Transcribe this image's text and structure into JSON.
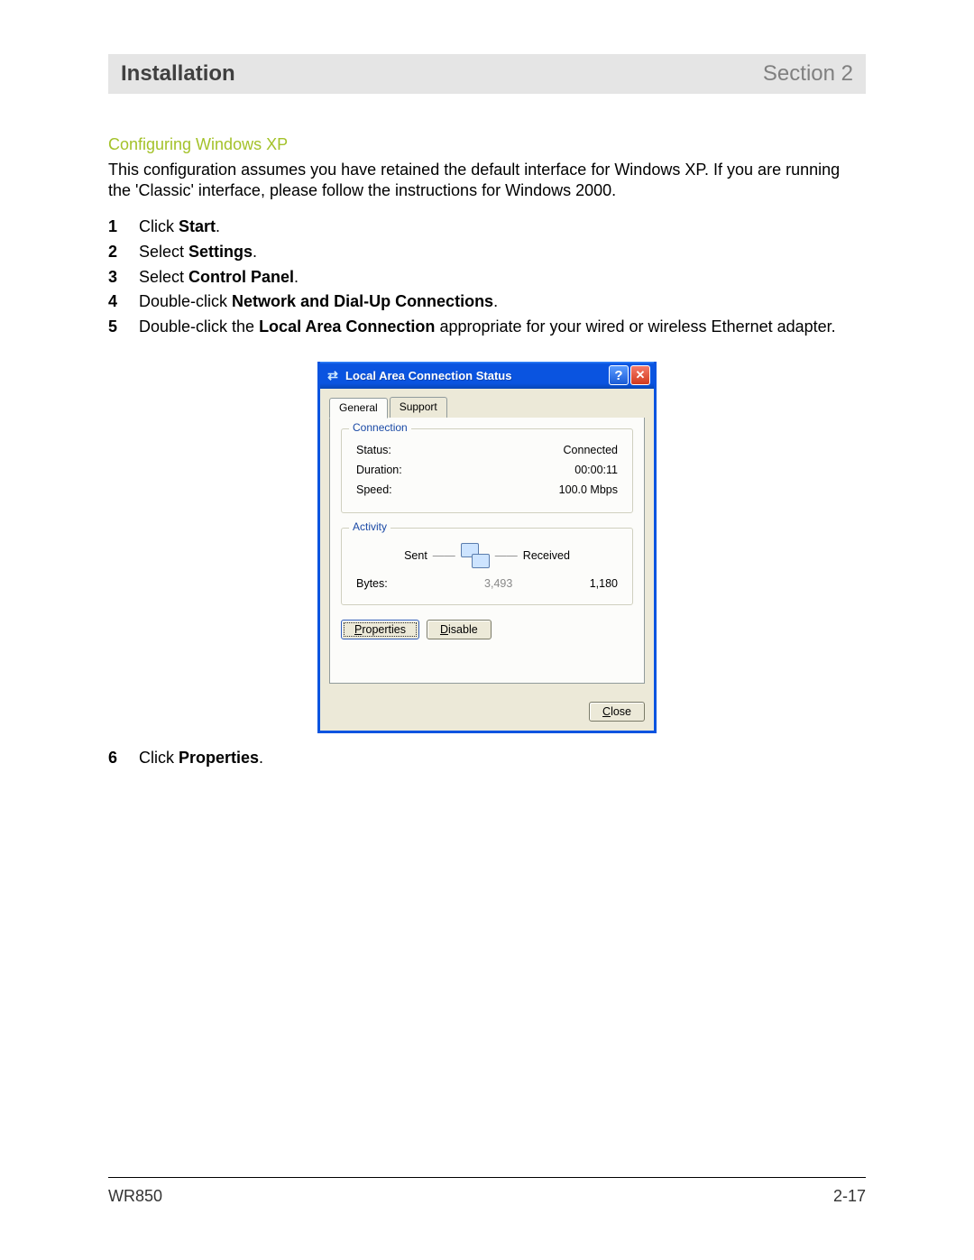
{
  "header": {
    "title": "Installation",
    "section": "Section 2"
  },
  "subheading": "Configuring Windows XP",
  "intro": "This configuration assumes you have retained the default interface for Windows XP. If you are running the 'Classic' interface, please follow the instructions for Windows 2000.",
  "steps": {
    "s1": {
      "num": "1",
      "pre": "Click ",
      "bold": "Start",
      "post": "."
    },
    "s2": {
      "num": "2",
      "pre": "Select ",
      "bold": "Settings",
      "post": "."
    },
    "s3": {
      "num": "3",
      "pre": "Select ",
      "bold": "Control Panel",
      "post": "."
    },
    "s4": {
      "num": "4",
      "pre": "Double-click ",
      "bold": "Network and Dial-Up Connections",
      "post": "."
    },
    "s5": {
      "num": "5",
      "pre": "Double-click the ",
      "bold": "Local Area Connection",
      "post": " appropriate for your wired or wireless Ethernet adapter."
    },
    "s6": {
      "num": "6",
      "pre": "Click ",
      "bold": "Properties",
      "post": "."
    }
  },
  "dialog": {
    "title": "Local Area Connection Status",
    "help_icon": "?",
    "close_icon": "✕",
    "tabs": {
      "general": "General",
      "support": "Support"
    },
    "group_connection": {
      "legend": "Connection",
      "status_label": "Status:",
      "status_value": "Connected",
      "duration_label": "Duration:",
      "duration_value": "00:00:11",
      "speed_label": "Speed:",
      "speed_value": "100.0 Mbps"
    },
    "group_activity": {
      "legend": "Activity",
      "sent_label": "Sent",
      "dash": "——",
      "received_label": "Received",
      "bytes_label": "Bytes:",
      "sent_value": "3,493",
      "sep": "|",
      "received_value": "1,180"
    },
    "buttons": {
      "properties_u": "P",
      "properties_rest": "roperties",
      "disable_u": "D",
      "disable_rest": "isable",
      "close_u": "C",
      "close_rest": "lose"
    }
  },
  "footer": {
    "model": "WR850",
    "page": "2-17"
  }
}
